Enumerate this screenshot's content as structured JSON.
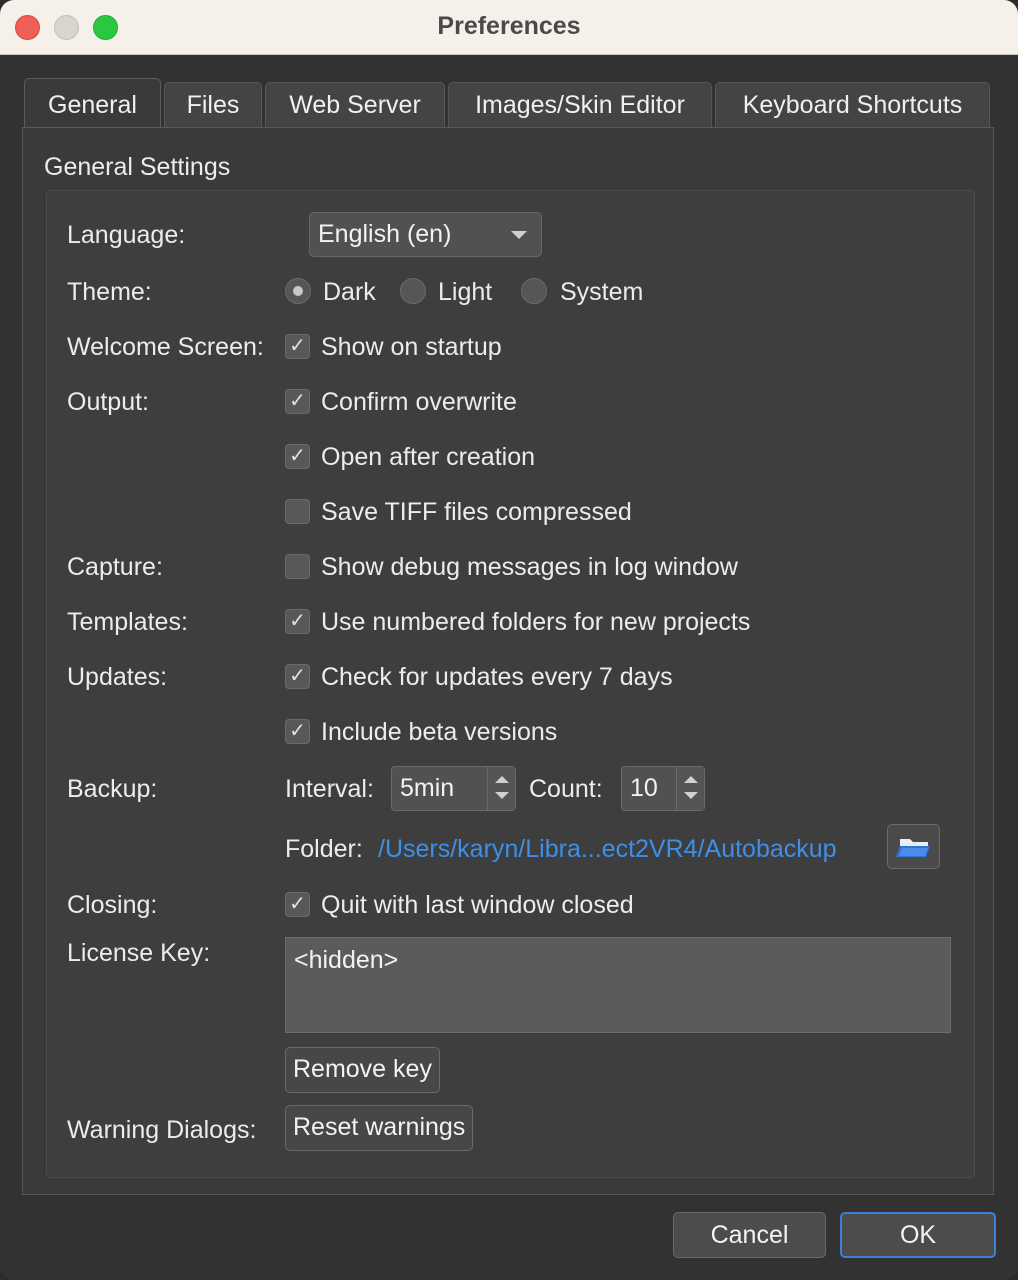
{
  "window": {
    "title": "Preferences"
  },
  "tabs": [
    {
      "label": "General",
      "active": true
    },
    {
      "label": "Files",
      "active": false
    },
    {
      "label": "Web Server",
      "active": false
    },
    {
      "label": "Images/Skin Editor",
      "active": false
    },
    {
      "label": "Keyboard Shortcuts",
      "active": false
    }
  ],
  "general": {
    "group_title": "General Settings",
    "language": {
      "label": "Language:",
      "value": "English (en)"
    },
    "theme": {
      "label": "Theme:",
      "options": [
        {
          "label": "Dark",
          "checked": true
        },
        {
          "label": "Light",
          "checked": false
        },
        {
          "label": "System",
          "checked": false
        }
      ]
    },
    "welcome": {
      "label": "Welcome Screen:",
      "show_on_startup": {
        "label": "Show on startup",
        "checked": true
      }
    },
    "output": {
      "label": "Output:",
      "confirm_overwrite": {
        "label": "Confirm overwrite",
        "checked": true
      },
      "open_after_creation": {
        "label": "Open after creation",
        "checked": true
      },
      "save_tiff_compressed": {
        "label": "Save TIFF files compressed",
        "checked": false
      }
    },
    "capture": {
      "label": "Capture:",
      "show_debug": {
        "label": "Show debug messages in log window",
        "checked": false
      }
    },
    "templates": {
      "label": "Templates:",
      "numbered_folders": {
        "label": "Use numbered folders for new projects",
        "checked": true
      }
    },
    "updates": {
      "label": "Updates:",
      "check_updates": {
        "label": "Check for updates every 7 days",
        "checked": true
      },
      "include_beta": {
        "label": "Include beta versions",
        "checked": true
      }
    },
    "backup": {
      "label": "Backup:",
      "interval_label": "Interval:",
      "interval_value": "5min",
      "count_label": "Count:",
      "count_value": "10",
      "folder_label": "Folder:",
      "folder_path": "/Users/karyn/Libra...ect2VR4/Autobackup"
    },
    "closing": {
      "label": "Closing:",
      "quit_last_window": {
        "label": "Quit with last window closed",
        "checked": true
      }
    },
    "license": {
      "label": "License Key:",
      "value": "<hidden>",
      "remove_button": "Remove key"
    },
    "warnings": {
      "label": "Warning Dialogs:",
      "reset_button": "Reset warnings"
    }
  },
  "buttons": {
    "cancel": "Cancel",
    "ok": "OK"
  },
  "colors": {
    "accent": "#3e7fd6",
    "link": "#3f8fe8",
    "background": "#323232"
  },
  "icons": {
    "folder_browse": "folder-icon",
    "checkmark": "✓"
  }
}
